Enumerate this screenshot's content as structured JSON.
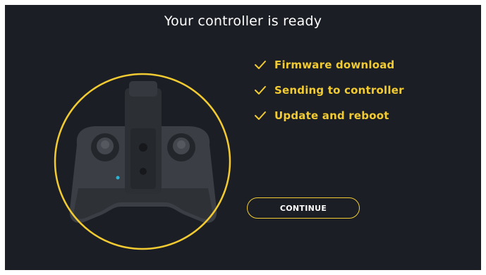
{
  "window": {
    "title": "Your controller is ready"
  },
  "checklist": {
    "items": [
      {
        "label": "Firmware download",
        "icon": "check-icon",
        "done": true
      },
      {
        "label": "Sending to controller",
        "icon": "check-icon",
        "done": true
      },
      {
        "label": "Update and reboot",
        "icon": "check-icon",
        "done": true
      }
    ]
  },
  "actions": {
    "continue_label": "CONTINUE"
  },
  "illustration": {
    "icon": "controller-icon"
  },
  "colors": {
    "background": "#1b1e24",
    "accent": "#f2cb33",
    "title_text": "#ffffff",
    "led": "#2ab3d6"
  }
}
